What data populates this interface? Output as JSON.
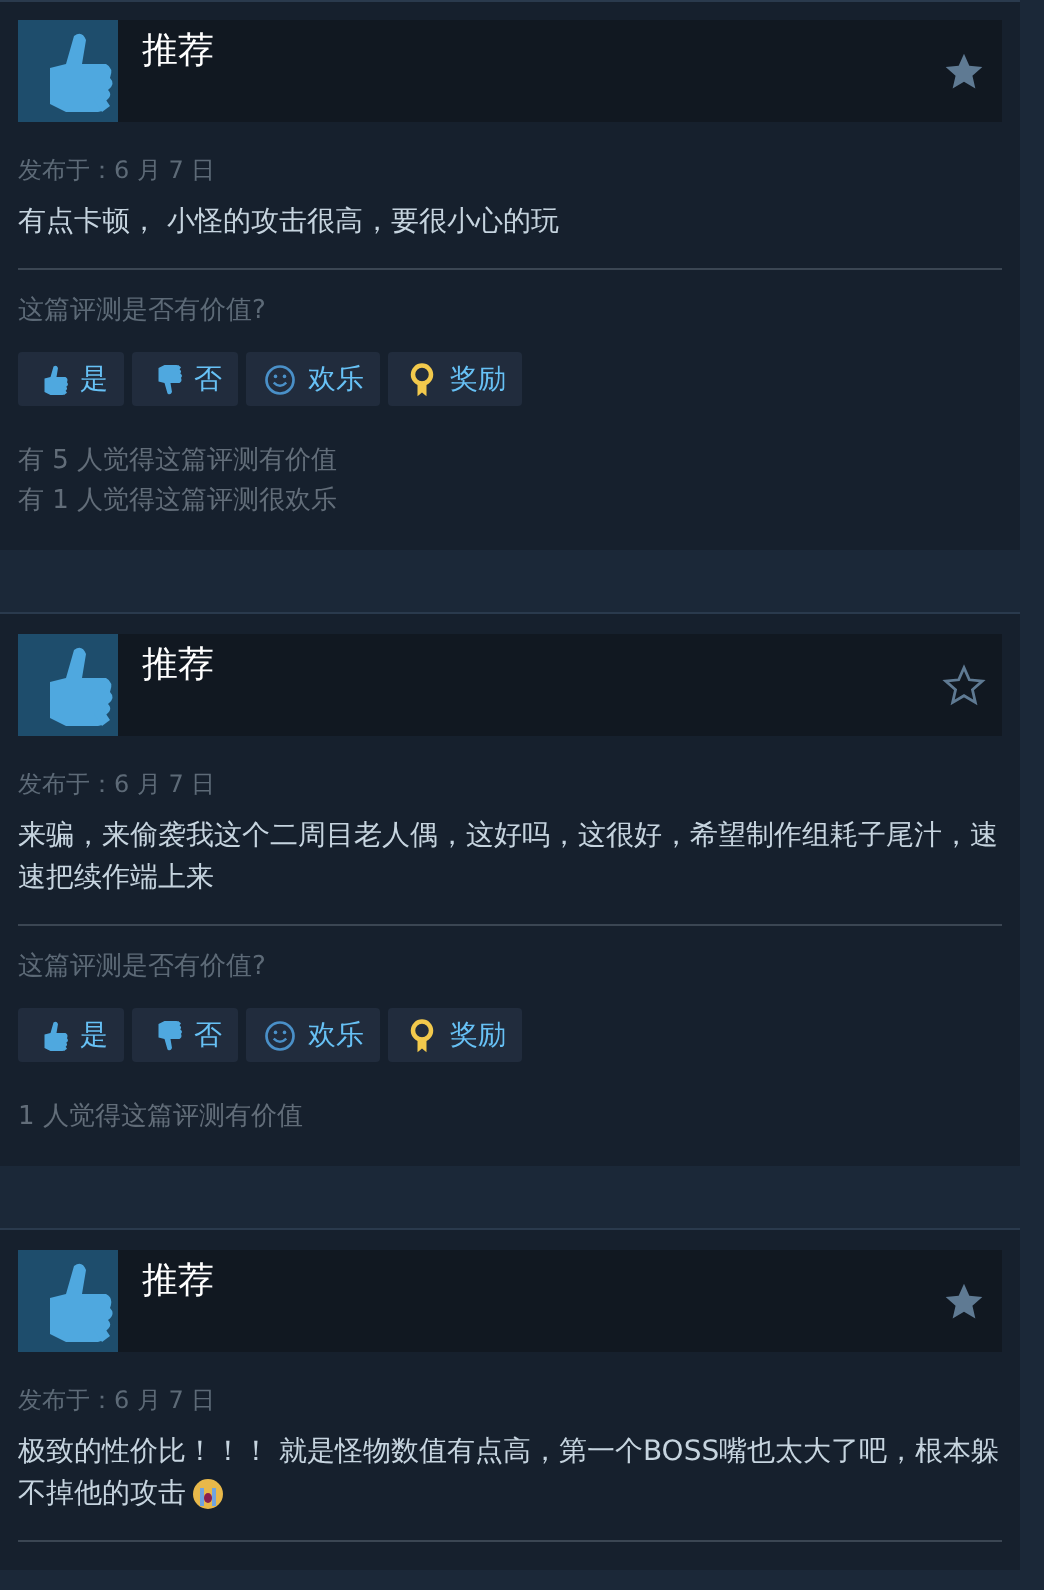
{
  "reviews": [
    {
      "verdict": "推荐",
      "favorited": true,
      "date": "发布于：6 月 7 日",
      "text": "有点卡顿， 小怪的攻击很高，要很小心的玩",
      "question": "这篇评测是否有价值?",
      "buttons": [
        {
          "kind": "yes",
          "label": "是"
        },
        {
          "kind": "no",
          "label": "否"
        },
        {
          "kind": "funny",
          "label": "欢乐"
        },
        {
          "kind": "award",
          "label": "奖励"
        }
      ],
      "counts": [
        "有 5 人觉得这篇评测有价值",
        "有 1 人觉得这篇评测很欢乐"
      ]
    },
    {
      "verdict": "推荐",
      "favorited": false,
      "date": "发布于：6 月 7 日",
      "text": "来骗，来偷袭我这个二周目老人偶，这好吗，这很好，希望制作组耗子尾汁，速速把续作端上来",
      "question": "这篇评测是否有价值?",
      "buttons": [
        {
          "kind": "yes",
          "label": "是"
        },
        {
          "kind": "no",
          "label": "否"
        },
        {
          "kind": "funny",
          "label": "欢乐"
        },
        {
          "kind": "award",
          "label": "奖励"
        }
      ],
      "counts": [
        "1 人觉得这篇评测有价值"
      ]
    },
    {
      "verdict": "推荐",
      "favorited": true,
      "date": "发布于：6 月 7 日",
      "text": "极致的性价比！！！ 就是怪物数值有点高，第一个BOSS嘴也太大了吧，根本躲不掉他的攻击",
      "emoji": true
    }
  ]
}
